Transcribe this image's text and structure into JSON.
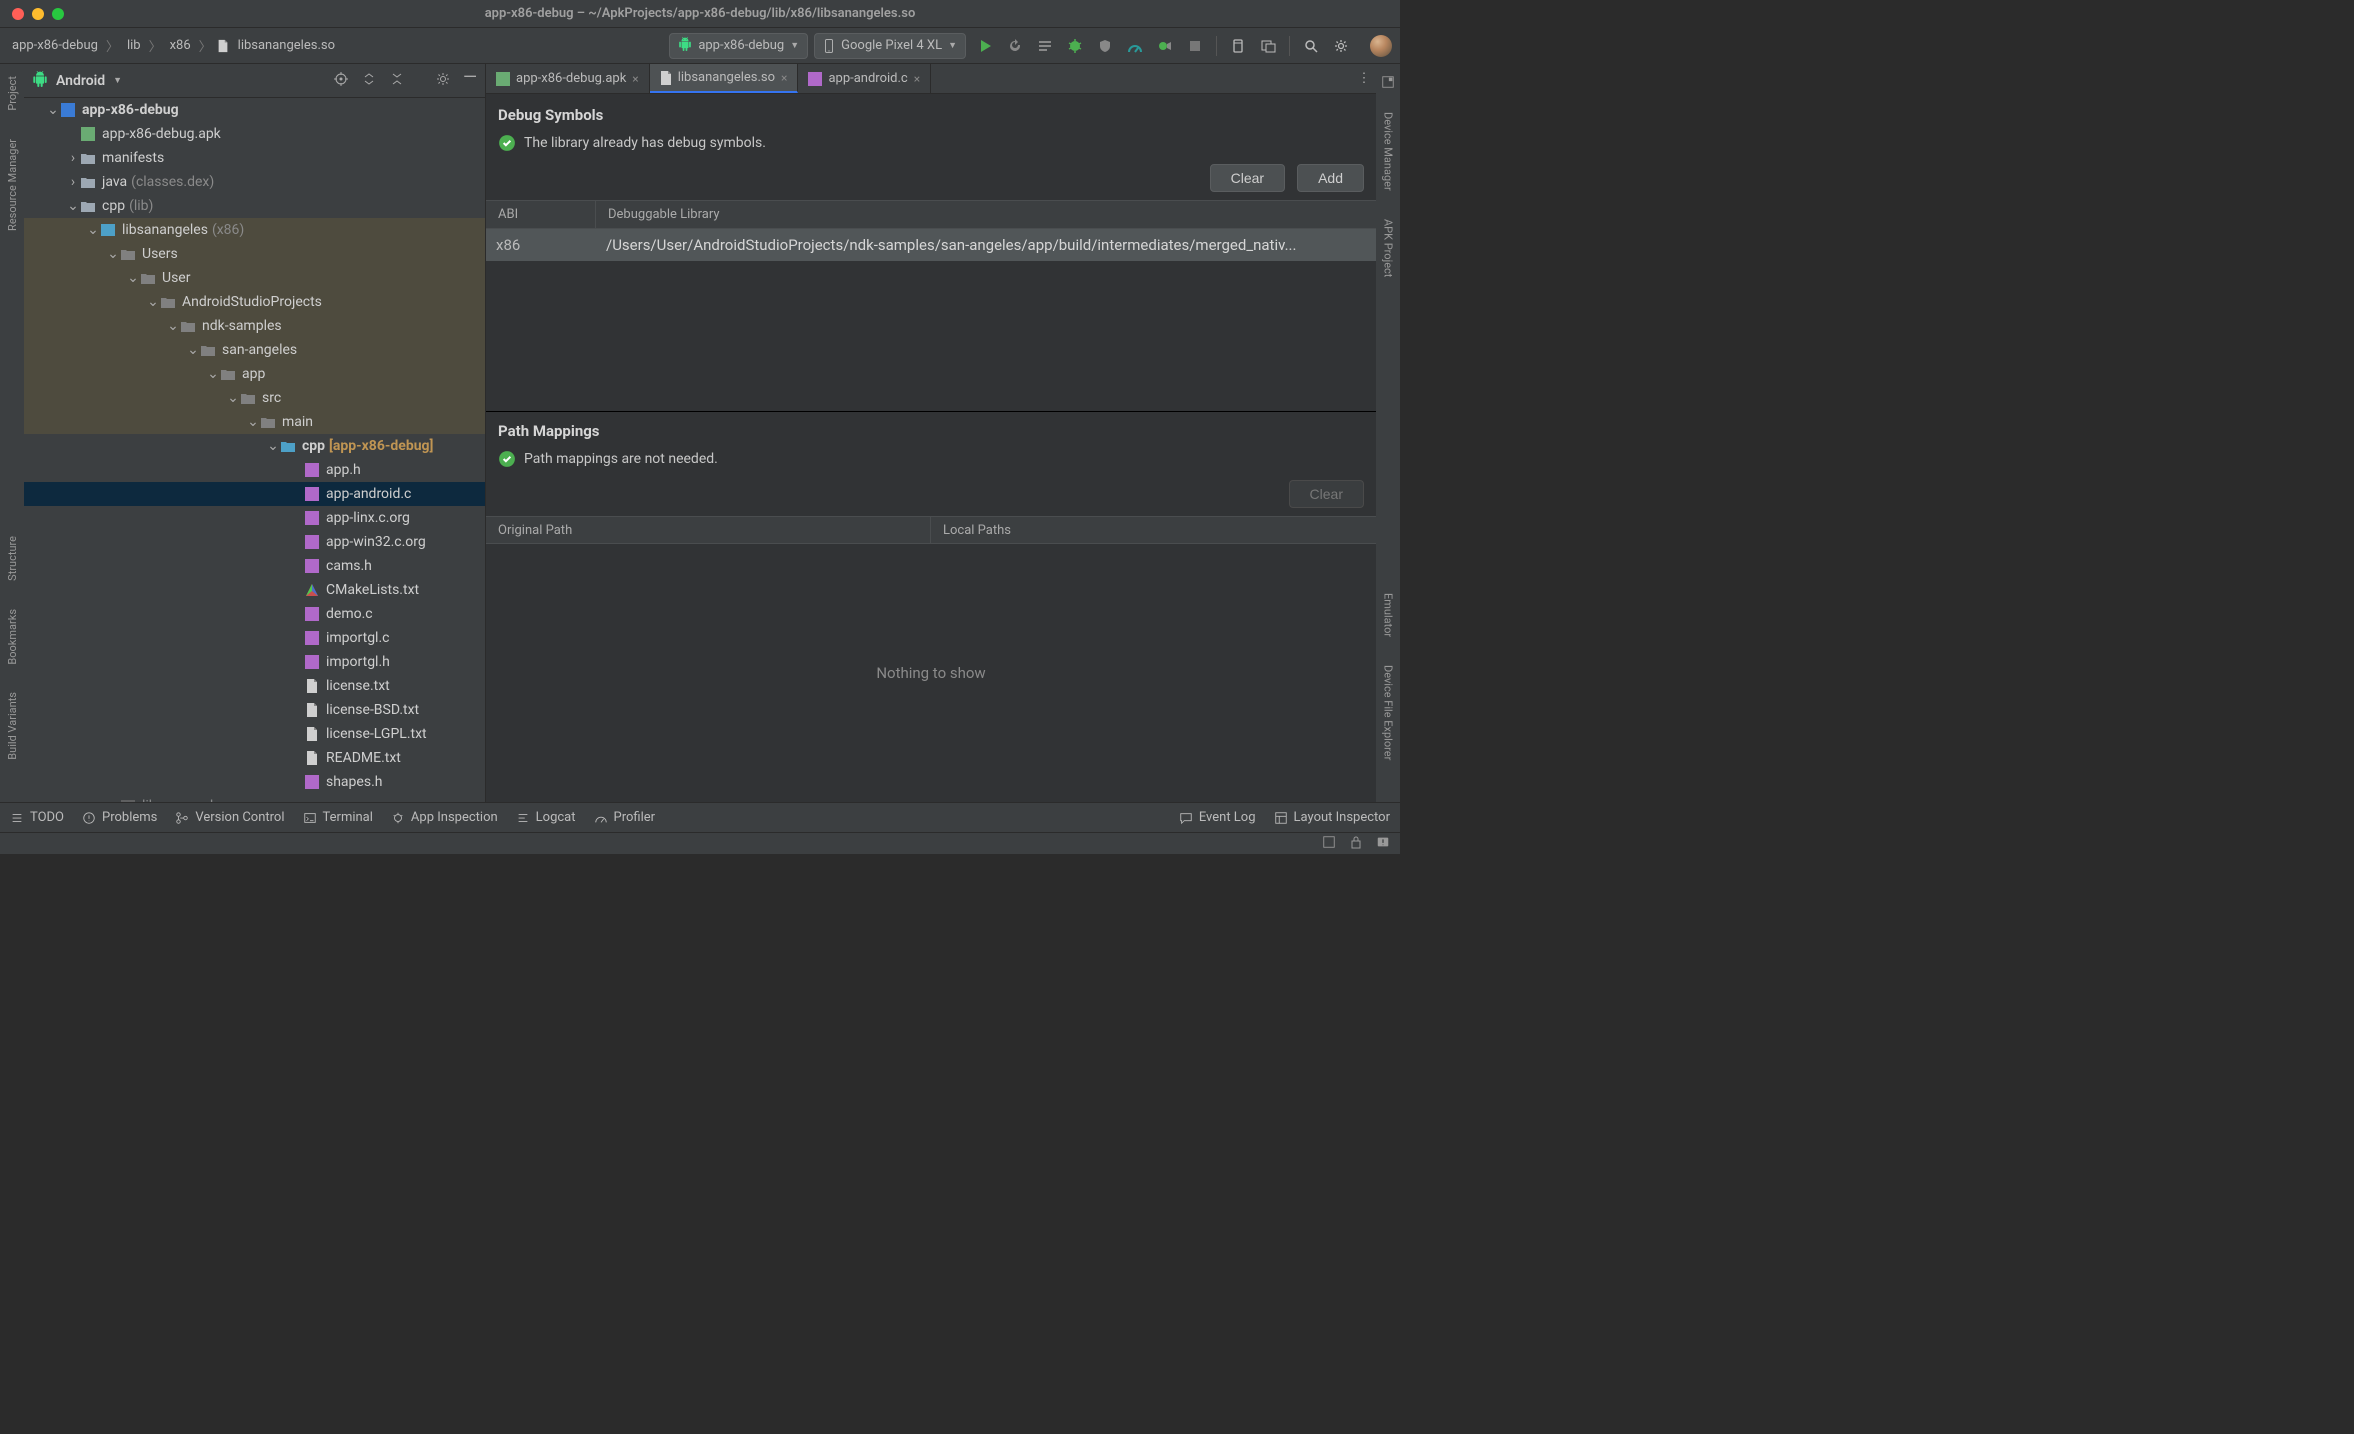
{
  "title": "app-x86-debug – ~/ApkProjects/app-x86-debug/lib/x86/libsanangeles.so",
  "breadcrumbs": [
    "app-x86-debug",
    "lib",
    "x86",
    "libsanangeles.so"
  ],
  "runConfig": "app-x86-debug",
  "device": "Google Pixel 4 XL",
  "projectHeader": "Android",
  "tree": {
    "root": "app-x86-debug",
    "apk": "app-x86-debug.apk",
    "manifests": "manifests",
    "java": "java",
    "javaHint": "(classes.dex)",
    "cpp": "cpp",
    "cppHint": "(lib)",
    "libsan": "libsanangeles",
    "libsanHint": "(x86)",
    "users": "Users",
    "user": "User",
    "asp": "AndroidStudioProjects",
    "ndk": "ndk-samples",
    "sanangeles": "san-angeles",
    "app": "app",
    "src": "src",
    "main": "main",
    "cppMod": "cpp",
    "cppModHint": "[app-x86-debug]",
    "files": {
      "apph": "app.h",
      "appandroidc": "app-android.c",
      "applinx": "app-linx.c.org",
      "appwin32": "app-win32.c.org",
      "camsh": "cams.h",
      "cmake": "CMakeLists.txt",
      "democ": "demo.c",
      "importglc": "importgl.c",
      "importglh": "importgl.h",
      "license": "license.txt",
      "licensebsd": "license-BSD.txt",
      "licenselgpl": "license-LGPL.txt",
      "readme": "README.txt",
      "shapesh": "shapes.h",
      "libso": "libsanangeles.so"
    }
  },
  "tabs": {
    "t1": "app-x86-debug.apk",
    "t2": "libsanangeles.so",
    "t3": "app-android.c"
  },
  "debugSymbols": {
    "title": "Debug Symbols",
    "status": "The library already has debug symbols.",
    "clearBtn": "Clear",
    "addBtn": "Add",
    "col1": "ABI",
    "col2": "Debuggable Library",
    "row": {
      "abi": "x86",
      "path": "/Users/User/AndroidStudioProjects/ndk-samples/san-angeles/app/build/intermediates/merged_nativ..."
    }
  },
  "pathMappings": {
    "title": "Path Mappings",
    "status": "Path mappings are not needed.",
    "clearBtn": "Clear",
    "col1": "Original Path",
    "col2": "Local Paths",
    "empty": "Nothing to show"
  },
  "leftRail": {
    "project": "Project",
    "resMgr": "Resource Manager",
    "structure": "Structure",
    "bookmarks": "Bookmarks",
    "buildVariants": "Build Variants"
  },
  "rightRail": {
    "deviceMgr": "Device Manager",
    "apkProject": "APK Project",
    "emulator": "Emulator",
    "dfe": "Device File Explorer"
  },
  "bottomBar": {
    "todo": "TODO",
    "problems": "Problems",
    "vcs": "Version Control",
    "terminal": "Terminal",
    "appInspection": "App Inspection",
    "logcat": "Logcat",
    "profiler": "Profiler",
    "eventLog": "Event Log",
    "layoutInspector": "Layout Inspector"
  }
}
